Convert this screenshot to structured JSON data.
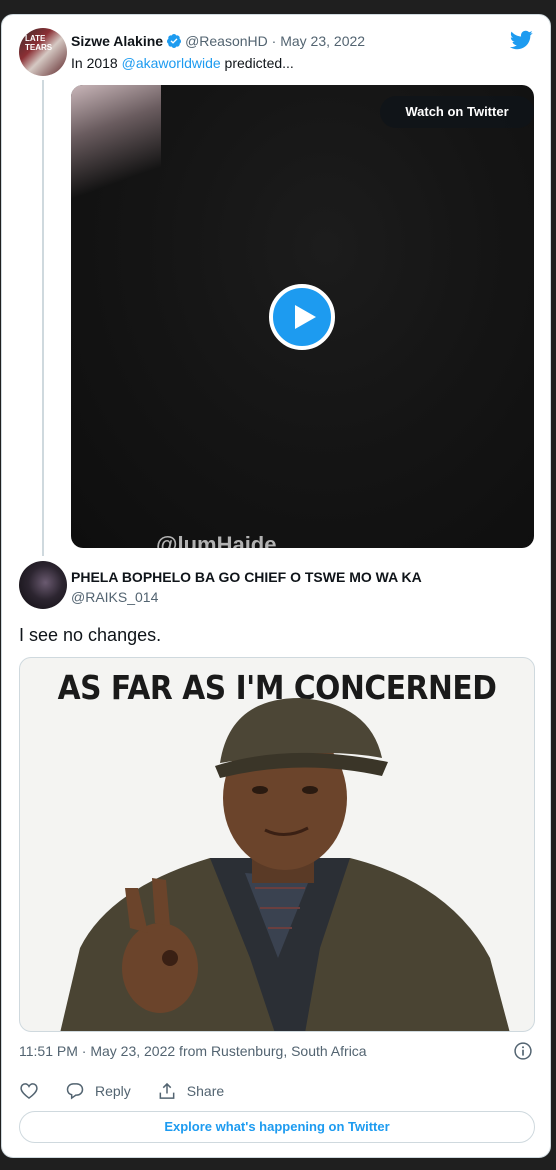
{
  "quoted_tweet": {
    "author_name": "Sizwe Alakine",
    "handle": "@ReasonHD",
    "separator": "·",
    "date": "May 23, 2022",
    "text_prefix": "In 2018 ",
    "mention": "@akaworldwide",
    "text_suffix": " predicted...",
    "video": {
      "watch_label": "Watch on Twitter",
      "watermark_text": "@lumHaide"
    }
  },
  "reply_tweet": {
    "author_name": "PHELA BOPHELO BA GO CHIEF O TSWE MO WA KA",
    "handle": "@RAIKS_014",
    "text": "I see no changes.",
    "image_caption": "AS FAR AS I'M CONCERNED",
    "timestamp": "11:51 PM · May 23, 2022 from Rustenburg, South Africa"
  },
  "actions": {
    "like_icon": "heart-icon",
    "reply_label": "Reply",
    "share_label": "Share"
  },
  "explore_label": "Explore what's happening on Twitter",
  "colors": {
    "accent": "#1d9bf0",
    "text": "#0f1419",
    "muted": "#536471",
    "border": "#cfd9de"
  }
}
